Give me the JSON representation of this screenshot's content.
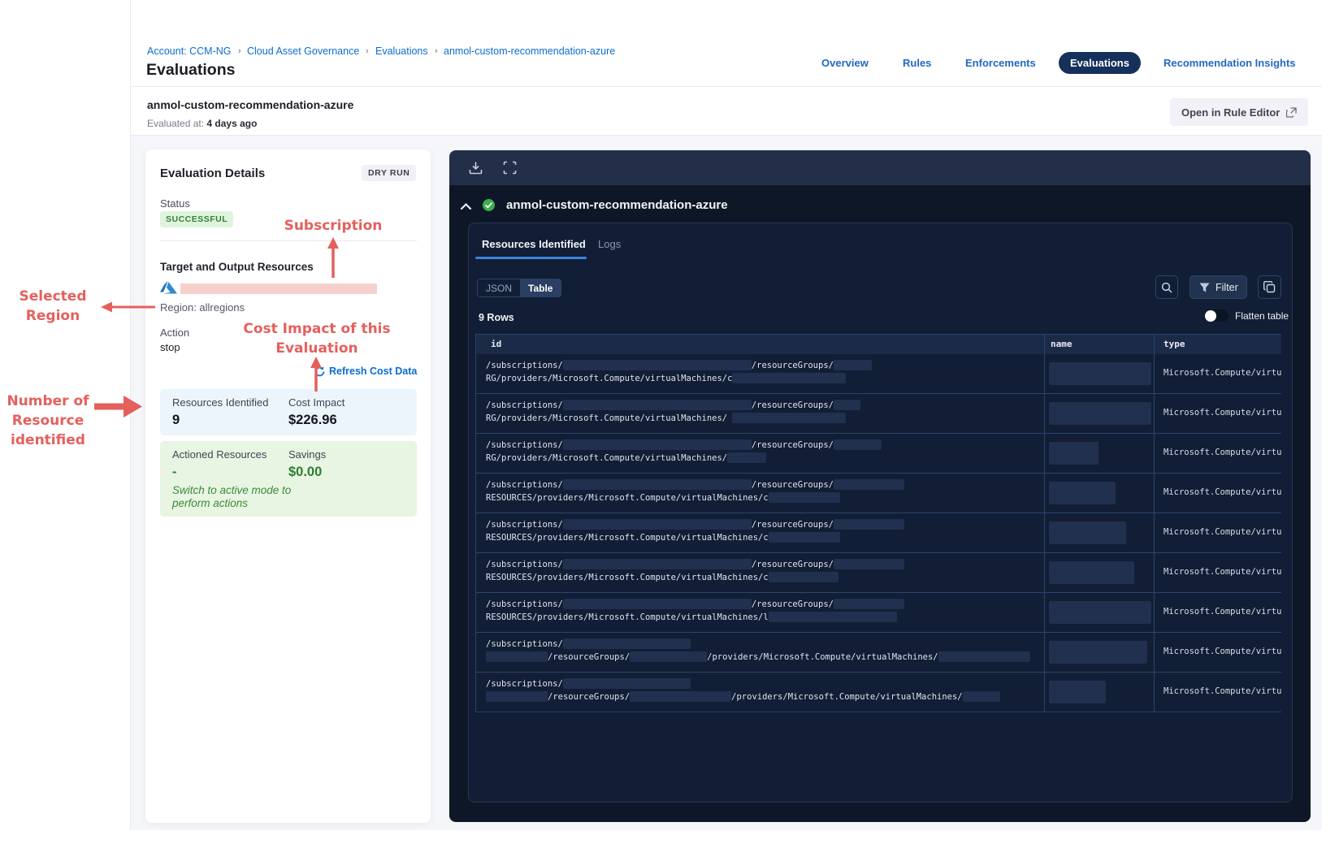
{
  "header": {
    "breadcrumb": [
      "Account: CCM-NG",
      "Cloud Asset Governance",
      "Evaluations",
      "anmol-custom-recommendation-azure"
    ],
    "breadcrumb_separator": "›",
    "page_title": "Evaluations",
    "nav_items": [
      {
        "label": "Overview",
        "active": false
      },
      {
        "label": "Rules",
        "active": false
      },
      {
        "label": "Enforcements",
        "active": false
      },
      {
        "label": "Evaluations",
        "active": true
      },
      {
        "label": "Recommendation Insights",
        "active": false
      }
    ]
  },
  "subheader": {
    "name": "anmol-custom-recommendation-azure",
    "evaluated_label": "Evaluated at:",
    "evaluated_value": "4 days ago",
    "open_button": "Open in Rule Editor"
  },
  "details_card": {
    "title": "Evaluation Details",
    "mode_badge": "DRY RUN",
    "status_label": "Status",
    "status_value": "SUCCESSFUL",
    "target_label": "Target and Output Resources",
    "cloud_icon": "azure-icon",
    "region": "Region: allregions",
    "action_label": "Action",
    "action_value": "stop",
    "refresh_link": "Refresh Cost Data",
    "resources_identified_label": "Resources Identified",
    "resources_identified_value": "9",
    "cost_impact_label": "Cost Impact",
    "cost_impact_value": "$226.96",
    "actioned_label": "Actioned Resources",
    "actioned_value": "-",
    "savings_label": "Savings",
    "savings_value": "$0.00",
    "note_line1": "Switch to active mode to",
    "note_line2": "perform actions"
  },
  "console": {
    "toolbar_icons": [
      "download-icon",
      "fullscreen-icon"
    ],
    "title": "anmol-custom-recommendation-azure",
    "status_icon": "success-check-icon",
    "tabs": [
      {
        "label": "Resources Identified",
        "active": true
      },
      {
        "label": "Logs",
        "active": false
      }
    ],
    "view_toggle": [
      {
        "label": "JSON",
        "active": false
      },
      {
        "label": "Table",
        "active": true
      }
    ],
    "filter_label": "Filter",
    "rows_count": "9 Rows",
    "flatten_label": "Flatten table",
    "table": {
      "columns": [
        "id",
        "name",
        "type"
      ],
      "type_value": "Microsoft.Compute/virtu",
      "rows": [
        {
          "l1": [
            {
              "t": "/subscriptions/"
            },
            {
              "b": 232
            },
            {
              "t": "/resourceGroups/"
            },
            {
              "b": 47
            }
          ],
          "l2": [
            {
              "t": "RG/providers/Microsoft.Compute/virtualMachines/c"
            },
            {
              "b": 140
            }
          ],
          "name_w": 126
        },
        {
          "l1": [
            {
              "t": "/subscriptions/"
            },
            {
              "b": 232
            },
            {
              "t": "/resourceGroups/"
            },
            {
              "b": 33
            }
          ],
          "l2": [
            {
              "t": "RG/providers/Microsoft.Compute/virtualMachines/ "
            },
            {
              "b": 140
            }
          ],
          "name_w": 126
        },
        {
          "l1": [
            {
              "t": "/subscriptions/"
            },
            {
              "b": 232
            },
            {
              "t": "/resourceGroups/"
            },
            {
              "b": 59
            }
          ],
          "l2": [
            {
              "t": "RG/providers/Microsoft.Compute/virtualMachines/"
            },
            {
              "b": 48
            }
          ],
          "name_w": 61
        },
        {
          "l1": [
            {
              "t": "/subscriptions/"
            },
            {
              "b": 232
            },
            {
              "t": "/resourceGroups/"
            },
            {
              "b": 87
            }
          ],
          "l2": [
            {
              "t": "RESOURCES/providers/Microsoft.Compute/virtualMachines/c"
            },
            {
              "b": 88
            }
          ],
          "name_w": 82
        },
        {
          "l1": [
            {
              "t": "/subscriptions/"
            },
            {
              "b": 232
            },
            {
              "t": "/resourceGroups/"
            },
            {
              "b": 87
            }
          ],
          "l2": [
            {
              "t": "RESOURCES/providers/Microsoft.Compute/virtualMachines/c"
            },
            {
              "b": 88
            }
          ],
          "name_w": 95
        },
        {
          "l1": [
            {
              "t": "/subscriptions/"
            },
            {
              "b": 232
            },
            {
              "t": "/resourceGroups/"
            },
            {
              "b": 87
            }
          ],
          "l2": [
            {
              "t": "RESOURCES/providers/Microsoft.Compute/virtualMachines/c"
            },
            {
              "b": 86
            }
          ],
          "name_w": 105
        },
        {
          "l1": [
            {
              "t": "/subscriptions/"
            },
            {
              "b": 232
            },
            {
              "t": "/resourceGroups/"
            },
            {
              "b": 87
            }
          ],
          "l2": [
            {
              "t": "RESOURCES/providers/Microsoft.Compute/virtualMachines/l"
            },
            {
              "b": 158
            }
          ],
          "name_w": 126
        },
        {
          "l1": [
            {
              "t": "/subscriptions/"
            },
            {
              "b": 157
            }
          ],
          "l2": [
            {
              "b": 76
            },
            {
              "t": "/resourceGroups/"
            },
            {
              "b": 95
            },
            {
              "t": "/providers/Microsoft.Compute/virtualMachines/"
            },
            {
              "b": 113
            }
          ],
          "name_w": 121
        },
        {
          "l1": [
            {
              "t": "/subscriptions/"
            },
            {
              "b": 157
            }
          ],
          "l2": [
            {
              "b": 76
            },
            {
              "t": "/resourceGroups/"
            },
            {
              "b": 125
            },
            {
              "t": "/providers/Microsoft.Compute/virtualMachines/"
            },
            {
              "b": 46
            }
          ],
          "name_w": 70
        }
      ]
    }
  },
  "annotations": {
    "color": "#e4605c",
    "subscription": {
      "line1": "Subscription"
    },
    "cost": {
      "line1": "Cost Impact of this",
      "line2": "Evaluation"
    },
    "region": {
      "line1": "Selected",
      "line2": "Region"
    },
    "count": {
      "line1": "Number of",
      "line2": "Resource",
      "line3": "identified"
    }
  }
}
